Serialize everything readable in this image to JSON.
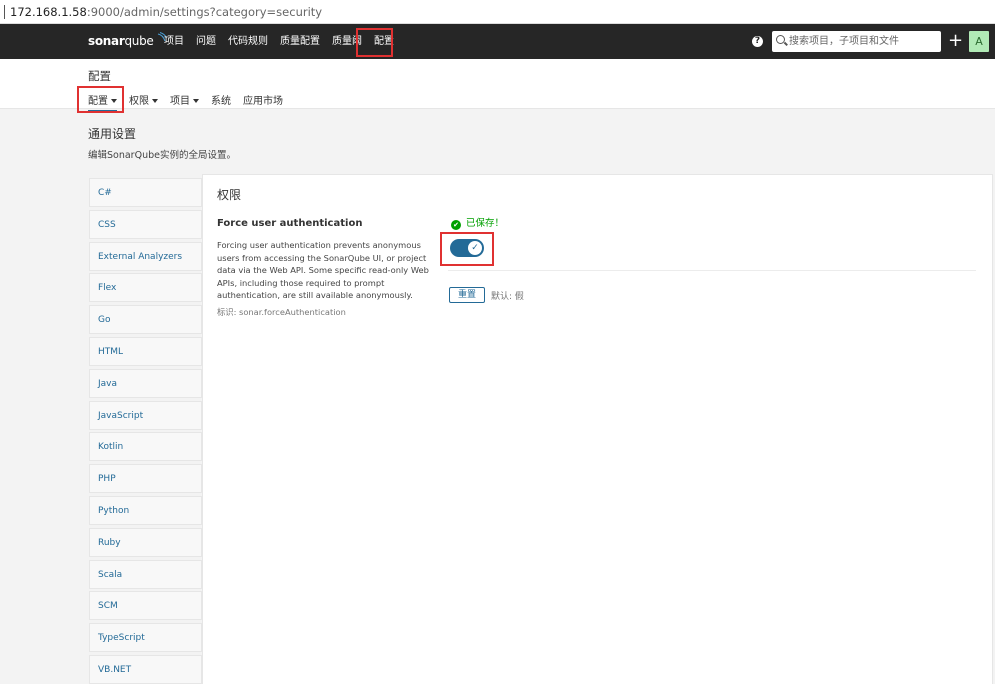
{
  "address_bar": {
    "host": "172.168.1.58",
    "path": ":9000/admin/settings?category=security"
  },
  "navbar": {
    "logo_main": "sonar",
    "logo_sub": "qube",
    "items": [
      {
        "label": "项目"
      },
      {
        "label": "问题"
      },
      {
        "label": "代码规则"
      },
      {
        "label": "质量配置"
      },
      {
        "label": "质量阈"
      },
      {
        "label": "配置"
      }
    ],
    "help_glyph": "?",
    "search_placeholder": "搜索项目，子项目和文件",
    "plus_glyph": "+",
    "avatar_letter": "A"
  },
  "page_header": {
    "title": "配置",
    "subnav": [
      {
        "label": "配置",
        "dropdown": true,
        "active": true
      },
      {
        "label": "权限",
        "dropdown": true
      },
      {
        "label": "项目",
        "dropdown": true
      },
      {
        "label": "系统",
        "dropdown": false
      },
      {
        "label": "应用市场",
        "dropdown": false
      }
    ]
  },
  "section": {
    "title": "通用设置",
    "description": "编辑SonarQube实例的全局设置。"
  },
  "categories": [
    "C#",
    "CSS",
    "External Analyzers",
    "Flex",
    "Go",
    "HTML",
    "Java",
    "JavaScript",
    "Kotlin",
    "PHP",
    "Python",
    "Ruby",
    "Scala",
    "SCM",
    "TypeScript",
    "VB.NET"
  ],
  "panel": {
    "title": "权限",
    "setting_name": "Force user authentication",
    "setting_description": "Forcing user authentication prevents anonymous users from accessing the SonarQube UI, or project data via the Web API. Some specific read-only Web APIs, including those required to prompt authentication, are still available anonymously.",
    "setting_key": "标识: sonar.forceAuthentication",
    "saved_text": "已保存！",
    "toggle_on": true,
    "reset_label": "重置",
    "default_text": "默认: 假"
  },
  "colors": {
    "navbar_bg": "#262626",
    "accent": "#236a97",
    "saved_green": "#00a000",
    "highlight_red": "#e03131",
    "avatar_bg": "#b1eab6"
  }
}
